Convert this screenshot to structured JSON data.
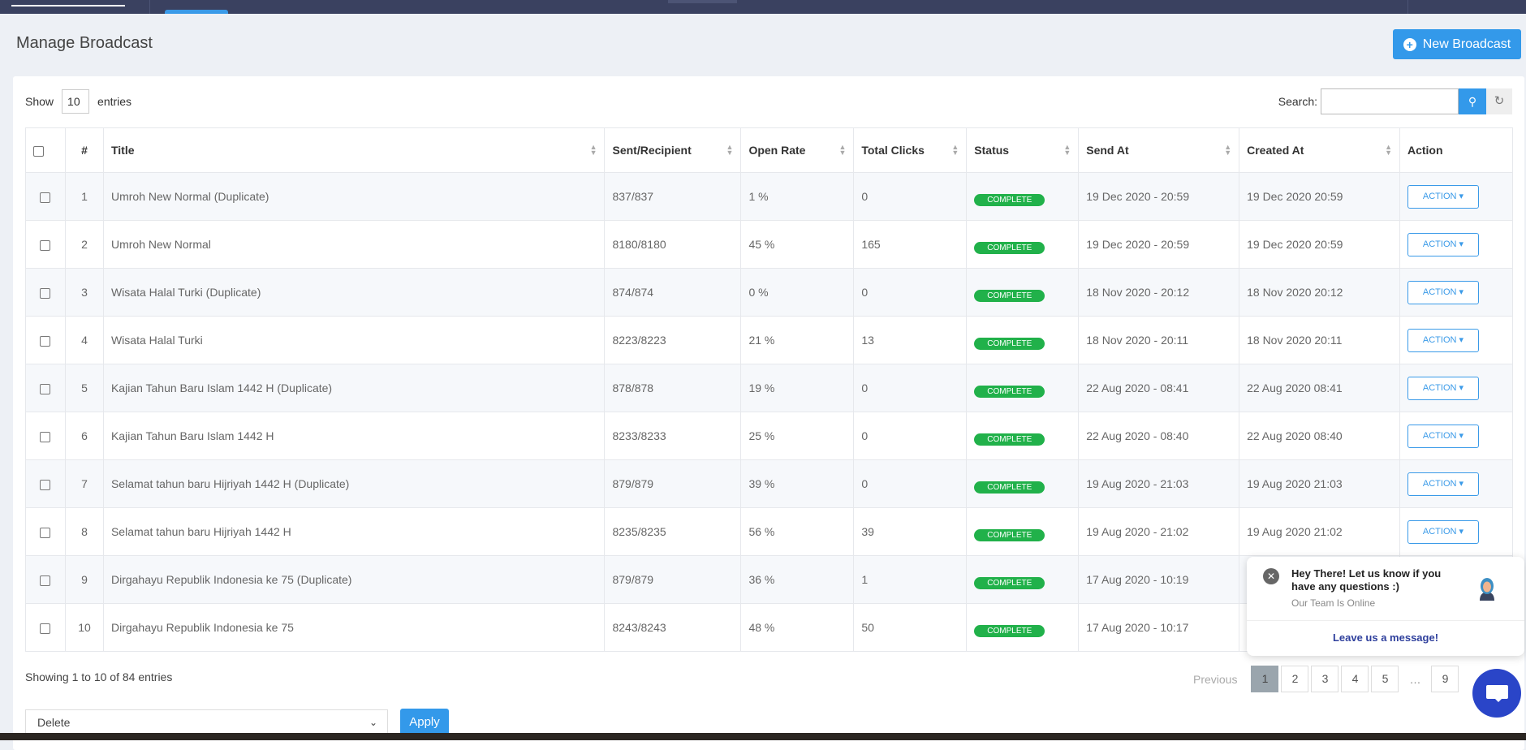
{
  "page": {
    "title": "Manage Broadcast",
    "new_button": "New Broadcast"
  },
  "controls": {
    "show_label": "Show",
    "entries_value": "10",
    "entries_label": "entries",
    "search_label": "Search:",
    "search_value": ""
  },
  "columns": [
    "#",
    "Title",
    "Sent/Recipient",
    "Open Rate",
    "Total Clicks",
    "Status",
    "Send At",
    "Created At",
    "Action"
  ],
  "rows": [
    {
      "n": "1",
      "title": "Umroh New Normal (Duplicate)",
      "sent": "837/837",
      "open": "1 %",
      "clicks": "0",
      "status": "COMPLETE",
      "send_at": "19 Dec 2020 - 20:59",
      "created_at": "19 Dec 2020 20:59",
      "action": "ACTION"
    },
    {
      "n": "2",
      "title": "Umroh New Normal",
      "sent": "8180/8180",
      "open": "45 %",
      "clicks": "165",
      "status": "COMPLETE",
      "send_at": "19 Dec 2020 - 20:59",
      "created_at": "19 Dec 2020 20:59",
      "action": "ACTION"
    },
    {
      "n": "3",
      "title": "Wisata Halal Turki (Duplicate)",
      "sent": "874/874",
      "open": "0 %",
      "clicks": "0",
      "status": "COMPLETE",
      "send_at": "18 Nov 2020 - 20:12",
      "created_at": "18 Nov 2020 20:12",
      "action": "ACTION"
    },
    {
      "n": "4",
      "title": "Wisata Halal Turki",
      "sent": "8223/8223",
      "open": "21 %",
      "clicks": "13",
      "status": "COMPLETE",
      "send_at": "18 Nov 2020 - 20:11",
      "created_at": "18 Nov 2020 20:11",
      "action": "ACTION"
    },
    {
      "n": "5",
      "title": "Kajian Tahun Baru Islam 1442 H (Duplicate)",
      "sent": "878/878",
      "open": "19 %",
      "clicks": "0",
      "status": "COMPLETE",
      "send_at": "22 Aug 2020 - 08:41",
      "created_at": "22 Aug 2020 08:41",
      "action": "ACTION"
    },
    {
      "n": "6",
      "title": "Kajian Tahun Baru Islam 1442 H",
      "sent": "8233/8233",
      "open": "25 %",
      "clicks": "0",
      "status": "COMPLETE",
      "send_at": "22 Aug 2020 - 08:40",
      "created_at": "22 Aug 2020 08:40",
      "action": "ACTION"
    },
    {
      "n": "7",
      "title": "Selamat tahun baru Hijriyah 1442 H (Duplicate)",
      "sent": "879/879",
      "open": "39 %",
      "clicks": "0",
      "status": "COMPLETE",
      "send_at": "19 Aug 2020 - 21:03",
      "created_at": "19 Aug 2020 21:03",
      "action": "ACTION"
    },
    {
      "n": "8",
      "title": "Selamat tahun baru Hijriyah 1442 H",
      "sent": "8235/8235",
      "open": "56 %",
      "clicks": "39",
      "status": "COMPLETE",
      "send_at": "19 Aug 2020 - 21:02",
      "created_at": "19 Aug 2020 21:02",
      "action": "ACTION"
    },
    {
      "n": "9",
      "title": "Dirgahayu Republik Indonesia ke 75 (Duplicate)",
      "sent": "879/879",
      "open": "36 %",
      "clicks": "1",
      "status": "COMPLETE",
      "send_at": "17 Aug 2020 - 10:19",
      "created_at": "",
      "action": ""
    },
    {
      "n": "10",
      "title": "Dirgahayu Republik Indonesia ke 75",
      "sent": "8243/8243",
      "open": "48 %",
      "clicks": "50",
      "status": "COMPLETE",
      "send_at": "17 Aug 2020 - 10:17",
      "created_at": "",
      "action": ""
    }
  ],
  "footer": {
    "info": "Showing 1 to 10 of 84 entries",
    "previous": "Previous",
    "pages": [
      "1",
      "2",
      "3",
      "4",
      "5",
      "…",
      "9"
    ],
    "current_page": "1",
    "bulk_value": "Delete",
    "apply": "Apply"
  },
  "chat": {
    "message": "Hey There! Let us know if you have any questions :)",
    "status": "Our Team Is Online",
    "leave": "Leave us a message!"
  },
  "colors": {
    "topbar": "#3a4160",
    "primary": "#3399ea",
    "complete": "#21b14a",
    "chat": "#2a45c8"
  }
}
